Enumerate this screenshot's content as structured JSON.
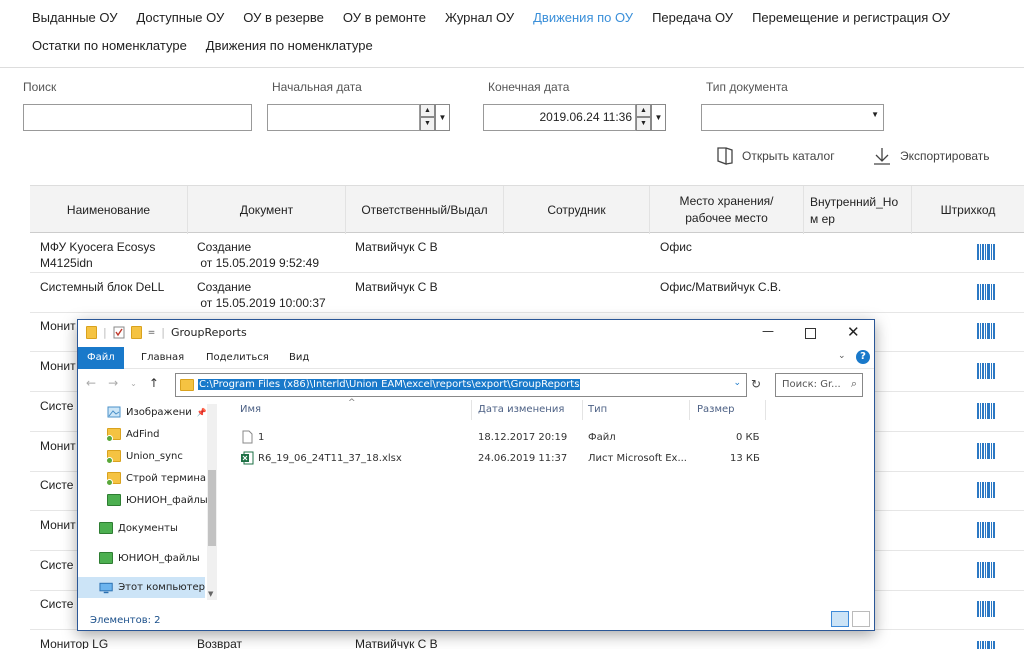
{
  "nav": {
    "row1": [
      "Выданные ОУ",
      "Доступные ОУ",
      "ОУ в резерве",
      "ОУ в ремонте",
      "Журнал ОУ",
      "Движения по ОУ",
      "Передача ОУ",
      "Перемещение и регистрация ОУ"
    ],
    "row2": [
      "Остатки по номенклатуре",
      "Движения по номенклатуре"
    ],
    "active": "Движения по ОУ"
  },
  "filters": {
    "search_label": "Поиск",
    "start_label": "Начальная дата",
    "end_label": "Конечная дата",
    "end_value": "2019.06.24 11:36",
    "doctype_label": "Тип документа"
  },
  "actions": {
    "open_catalog": "Открыть каталог",
    "export": "Экспортировать"
  },
  "table": {
    "headers": [
      "Наименование",
      "Документ",
      "Ответственный/Выдал",
      "Сотрудник",
      "Место хранения/ рабочее место",
      "Внутренний_Ном ер",
      "Штрихкод"
    ],
    "rows": [
      {
        "name": "МФУ Kyocera Ecosys",
        "name2": "M4125idn",
        "doc": "Создание",
        "doc2": " от 15.05.2019 9:52:49",
        "resp": "Матвийчук С В",
        "place": "Офис"
      },
      {
        "name": "Системный блок DeLL",
        "name2": "",
        "doc": "Создание",
        "doc2": " от 15.05.2019 10:00:37",
        "resp": "Матвийчук С В",
        "place": "Офис/Матвийчук С.В."
      },
      {
        "name": "Монит",
        "name2": "",
        "doc": "",
        "doc2": "",
        "resp": "",
        "place": ""
      },
      {
        "name": "Монит",
        "name2": "",
        "doc": "",
        "doc2": "",
        "resp": "",
        "place": ""
      },
      {
        "name": "Систе",
        "name2": "",
        "doc": "",
        "doc2": "",
        "resp": "",
        "place": ""
      },
      {
        "name": "Монит",
        "name2": "",
        "doc": "",
        "doc2": "",
        "resp": "",
        "place": ""
      },
      {
        "name": "Систе",
        "name2": "",
        "doc": "",
        "doc2": "",
        "resp": "",
        "place": ""
      },
      {
        "name": "Монит",
        "name2": "",
        "doc": "",
        "doc2": "",
        "resp": "",
        "place": ""
      },
      {
        "name": "Систе",
        "name2": "",
        "doc": "",
        "doc2": "",
        "resp": "",
        "place": ""
      },
      {
        "name": "Систе",
        "name2": "",
        "doc": "",
        "doc2": "",
        "resp": "",
        "place": ""
      },
      {
        "name": "Монитор LG",
        "name2": "",
        "doc": "Возврат",
        "doc2": "",
        "resp": "Матвийчук С В",
        "place": ""
      }
    ]
  },
  "explorer": {
    "title": "GroupReports",
    "ribbon": [
      "Файл",
      "Главная",
      "Поделиться",
      "Вид"
    ],
    "path": "C:\\Program Files (x86)\\Interld\\Union EAM\\excel\\reports\\export\\GroupReports",
    "search_placeholder": "Поиск: Gr...",
    "nav_items": [
      "Изображени",
      "AdFind",
      "Union_sync",
      "Строй термина",
      "ЮНИОН_файлы",
      "Документы",
      "ЮНИОН_файлы",
      "Этот компьютер"
    ],
    "columns": [
      "Имя",
      "Дата изменения",
      "Тип",
      "Размер"
    ],
    "files": [
      {
        "name": "1",
        "date": "18.12.2017 20:19",
        "type": "Файл",
        "size": "0 КБ"
      },
      {
        "name": "R6_19_06_24T11_37_18.xlsx",
        "date": "24.06.2019 11:37",
        "type": "Лист Microsoft Ex...",
        "size": "13 КБ"
      }
    ],
    "status": "Элементов: 2"
  }
}
